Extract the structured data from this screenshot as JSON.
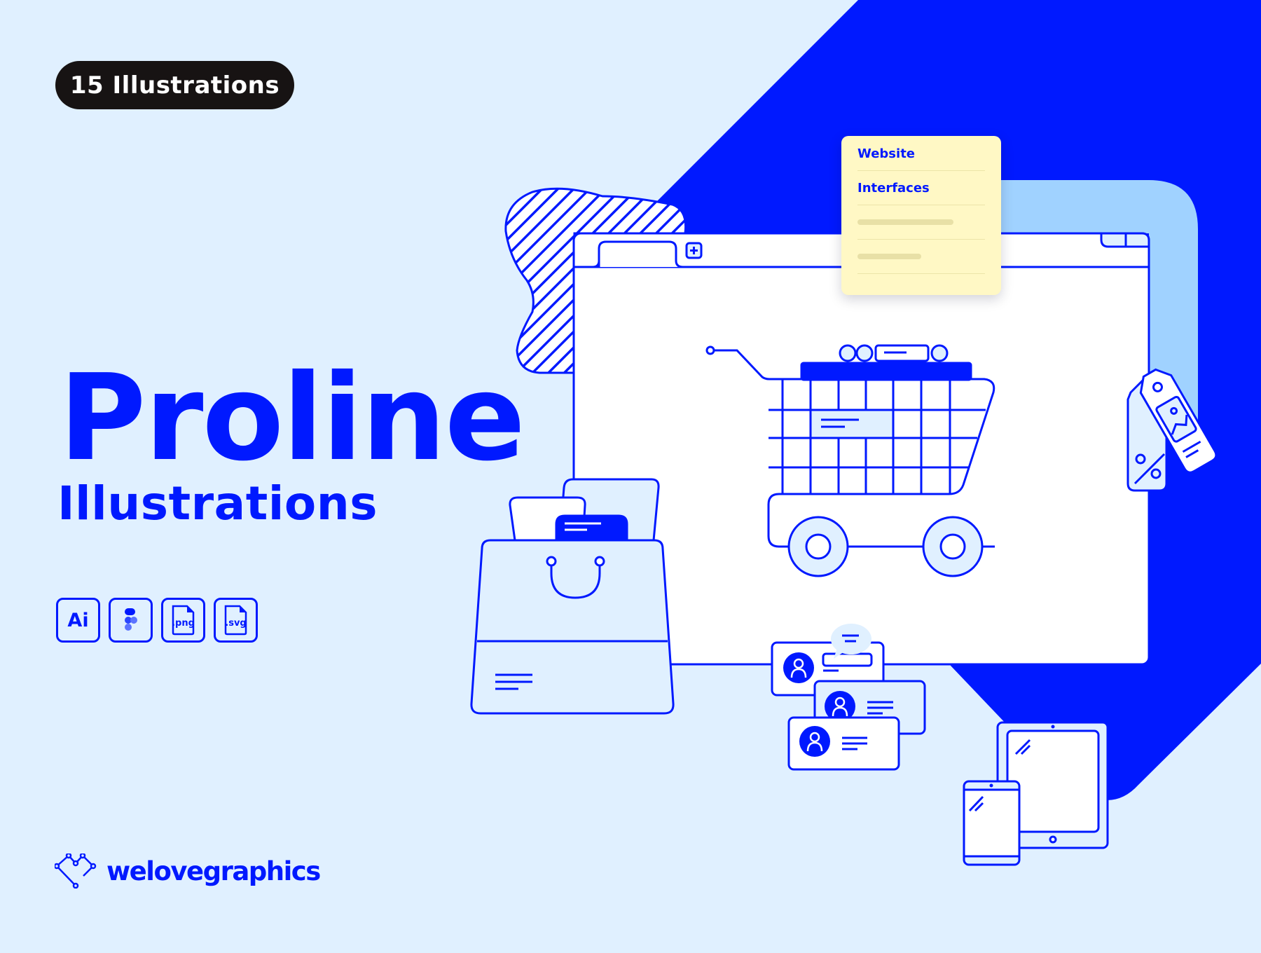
{
  "badge": {
    "label": "15 Illustrations"
  },
  "hero": {
    "title": "Proline",
    "subtitle": "Illustrations"
  },
  "formats": [
    {
      "label": "Ai",
      "icon": "adobe-illustrator-icon"
    },
    {
      "label": "",
      "icon": "figma-icon"
    },
    {
      "label": ".png",
      "icon": "png-file-icon"
    },
    {
      "label": ".svg",
      "icon": "svg-file-icon"
    }
  ],
  "brand": {
    "name": "welovegraphics",
    "icon": "welovegraphics-logo-icon"
  },
  "note": {
    "items": [
      "Website",
      "Interfaces"
    ],
    "placeholder_rows": 2
  },
  "colors": {
    "background": "#e0f0ff",
    "accent_blue": "#0019ff",
    "light_blue": "#a0d2ff",
    "badge_dark": "#171313",
    "note_yellow": "#fff8c5",
    "white": "#ffffff"
  }
}
